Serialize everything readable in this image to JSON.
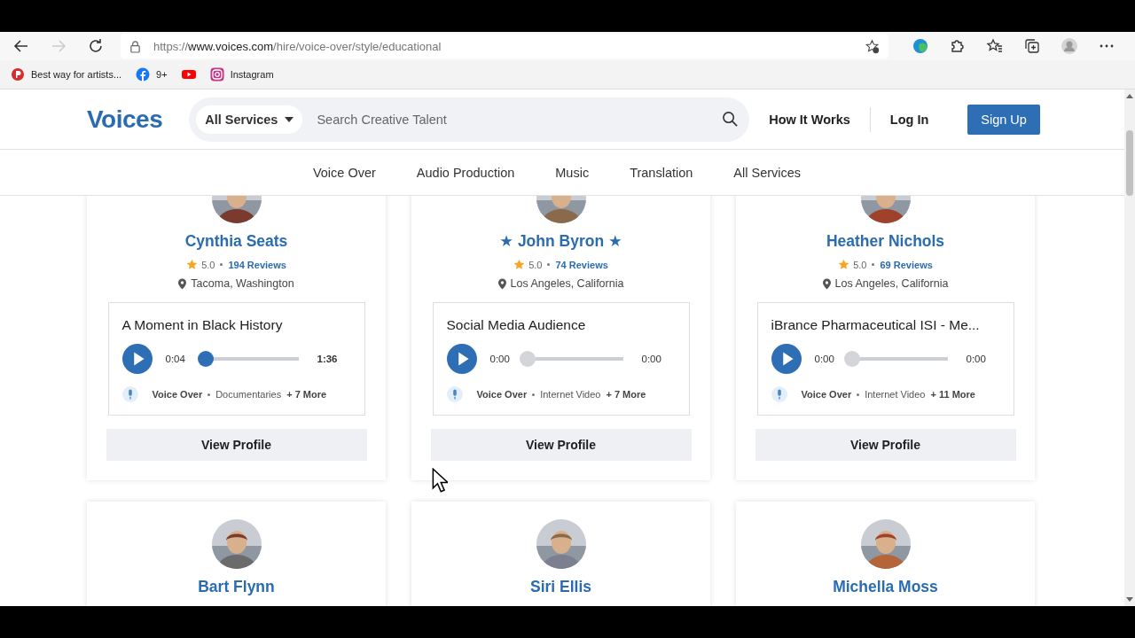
{
  "browser": {
    "url": {
      "scheme": "https://",
      "host": "www.voices.com",
      "path": "/hire/voice-over/style/educational"
    },
    "bookmarks": [
      {
        "kind": "pin",
        "label": "Best way for artists..."
      },
      {
        "kind": "facebook",
        "label": "9+"
      },
      {
        "kind": "youtube"
      },
      {
        "kind": "instagram",
        "label": "Instagram"
      }
    ]
  },
  "header": {
    "logo": "Voices",
    "service_select": "All Services",
    "search": {
      "placeholder": "Search Creative Talent"
    },
    "links": [
      "How It Works",
      "Log In"
    ],
    "signup": "Sign Up"
  },
  "nav": [
    "Voice Over",
    "Audio Production",
    "Music",
    "Translation",
    "All Services"
  ],
  "talents": [
    {
      "name": "Cynthia Seats",
      "rating": "5.0",
      "reviews": "194 Reviews",
      "location": "Tacoma, Washington",
      "demo": {
        "title": "A Moment in Black History",
        "current": "0:04",
        "duration": "1:36",
        "level": 0.03,
        "category": "Voice Over",
        "subcategory": "Documentaries",
        "more": "+ 7 More"
      },
      "button": "View Profile"
    },
    {
      "name": "★ John Byron ★",
      "rating": "5.0",
      "reviews": "74 Reviews",
      "location": "Los Angeles, California",
      "demo": {
        "title": "Social Media Audience",
        "current": "0:00",
        "duration": "0:00",
        "level": 0,
        "category": "Voice Over",
        "subcategory": "Internet Video",
        "more": "+ 7 More"
      },
      "button": "View Profile"
    },
    {
      "name": "Heather Nichols",
      "rating": "5.0",
      "reviews": "69 Reviews",
      "location": "Los Angeles, California",
      "demo": {
        "title": "iBrance Pharmaceutical ISI - Me...",
        "current": "0:00",
        "duration": "0:00",
        "level": 0,
        "category": "Voice Over",
        "subcategory": "Internet Video",
        "more": "+ 11 More"
      },
      "button": "View Profile"
    },
    {
      "name": "Bart Flynn"
    },
    {
      "name": "Siri Ellis"
    },
    {
      "name": "Michella Moss"
    }
  ]
}
